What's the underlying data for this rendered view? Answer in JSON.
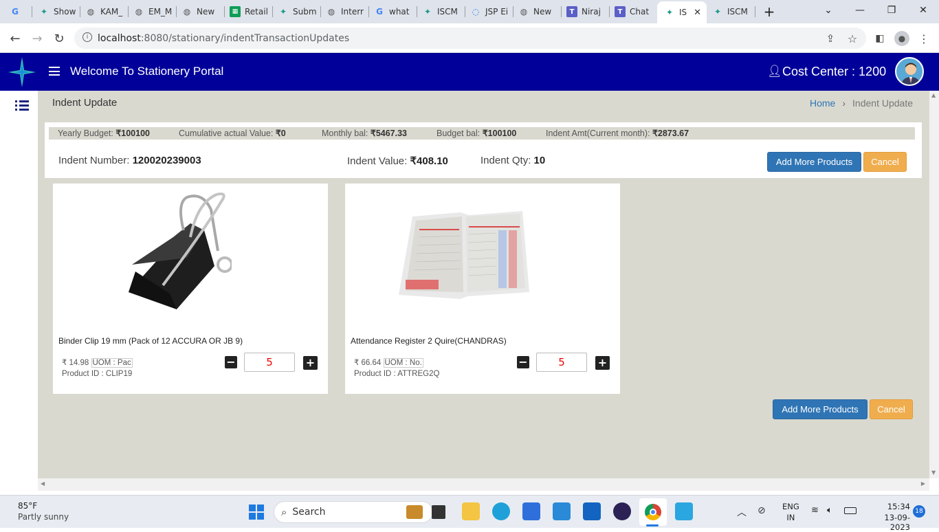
{
  "tabs": [
    {
      "label": "",
      "icon": "google-icon"
    },
    {
      "label": "Show",
      "icon": "star-icon"
    },
    {
      "label": "KAM_",
      "icon": "globe-icon"
    },
    {
      "label": "EM_M",
      "icon": "globe-icon"
    },
    {
      "label": "New",
      "icon": "globe-icon"
    },
    {
      "label": "Retail",
      "icon": "sheets-icon"
    },
    {
      "label": "Subm",
      "icon": "star-icon"
    },
    {
      "label": "Interr",
      "icon": "globe-icon"
    },
    {
      "label": "what",
      "icon": "google-icon"
    },
    {
      "label": "ISCM",
      "icon": "star-icon"
    },
    {
      "label": "JSP Ei",
      "icon": "jsp-icon"
    },
    {
      "label": "New",
      "icon": "globe-icon"
    },
    {
      "label": "Niraj",
      "icon": "teams-icon"
    },
    {
      "label": "Chat",
      "icon": "teams-icon"
    },
    {
      "label": "IS",
      "icon": "star-icon"
    },
    {
      "label": "ISCM",
      "icon": "star-icon"
    }
  ],
  "address": {
    "host": "localhost",
    "path": ":8080/stationary/indentTransactionUpdates"
  },
  "header": {
    "title": "Welcome To Stationery Portal",
    "cost_center": "Cost Center : 1200"
  },
  "page": {
    "title": "Indent Update",
    "breadcrumb_home": "Home",
    "breadcrumb_current": "Indent Update"
  },
  "budget": {
    "yearly_label": "Yearly Budget: ",
    "yearly_value": "₹100100",
    "cumulative_label": "Cumulative actual Value: ",
    "cumulative_value": "₹0",
    "monthly_label": "Monthly bal: ",
    "monthly_value": "₹5467.33",
    "budget_bal_label": "Budget bal: ",
    "budget_bal_value": "₹100100",
    "indent_amt_label": "Indent Amt(Current month): ",
    "indent_amt_value": "₹2873.67"
  },
  "indent": {
    "number_label": "Indent Number: ",
    "number_value": "120020239003",
    "value_label": "Indent Value: ",
    "value_value": "₹408.10",
    "qty_label": "Indent Qty: ",
    "qty_value": "10"
  },
  "buttons": {
    "add_more": "Add More Products",
    "cancel": "Cancel"
  },
  "products": [
    {
      "name": "Binder Clip 19 mm (Pack of 12 ACCURA OR JB 9)",
      "price": "₹ 14.98",
      "uom": "UOM : Pac",
      "product_id": "Product ID : CLIP19",
      "qty": "5"
    },
    {
      "name": "Attendance Register 2 Quire(CHANDRAS)",
      "price": "₹ 66.64",
      "uom": "UOM : No.",
      "product_id": "Product ID : ATTREG2Q",
      "qty": "5"
    }
  ],
  "taskbar": {
    "weather_temp": "85°F",
    "weather_desc": "Partly sunny",
    "search": "Search",
    "lang1": "ENG",
    "lang2": "IN",
    "time": "15:34",
    "date": "13-09-2023",
    "notif": "18"
  },
  "colors": {
    "header": "#01019a",
    "content_bg": "#d9d9d0",
    "btn_blue": "#2f75b5",
    "btn_orange": "#f0ad4e"
  }
}
